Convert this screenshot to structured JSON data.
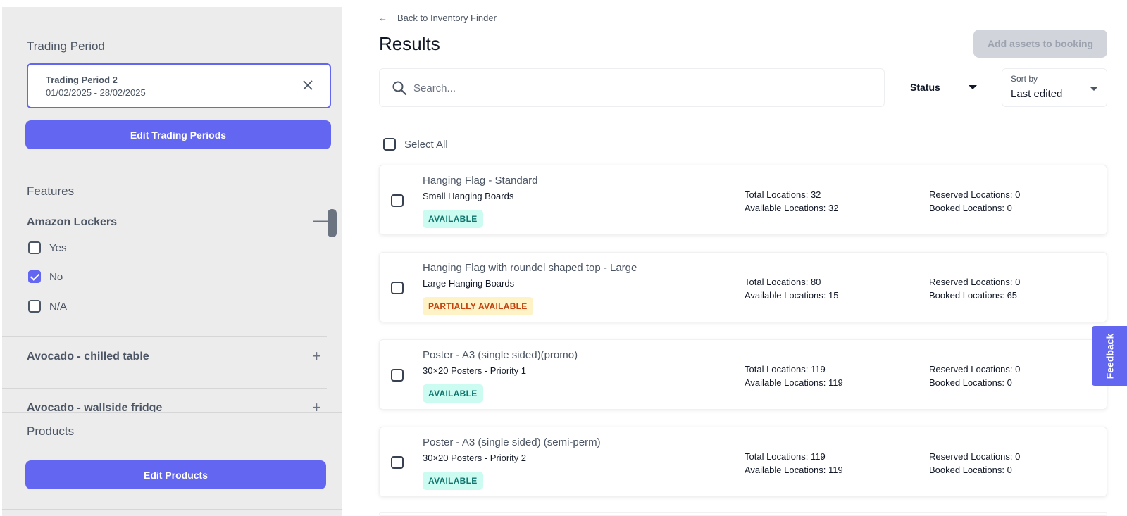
{
  "sidebar": {
    "trading_period": {
      "title": "Trading Period",
      "selected_name": "Trading Period 2",
      "selected_range": "01/02/2025 - 28/02/2025",
      "edit_label": "Edit Trading Periods"
    },
    "features": {
      "title": "Features",
      "groups": [
        {
          "label": "Amazon Lockers",
          "expanded": true,
          "options": [
            {
              "label": "Yes",
              "checked": false
            },
            {
              "label": "No",
              "checked": true
            },
            {
              "label": "N/A",
              "checked": false
            }
          ]
        },
        {
          "label": "Avocado - chilled table",
          "expanded": false
        },
        {
          "label": "Avocado - wallside fridge",
          "expanded": false
        }
      ]
    },
    "products": {
      "title": "Products",
      "edit_label": "Edit Products"
    }
  },
  "main": {
    "back_label": "Back to Inventory Finder",
    "title": "Results",
    "add_button": "Add assets to booking",
    "search_placeholder": "Search...",
    "status_label": "Status",
    "sort": {
      "label": "Sort by",
      "value": "Last edited"
    },
    "select_all": "Select All",
    "results": [
      {
        "title": "Hanging Flag - Standard",
        "subtitle": "Small Hanging Boards",
        "status": "AVAILABLE",
        "total": "Total Locations: 32",
        "available": "Available Locations: 32",
        "reserved": "Reserved Locations: 0",
        "booked": "Booked Locations: 0"
      },
      {
        "title": "Hanging Flag with roundel shaped top - Large",
        "subtitle": "Large Hanging Boards",
        "status": "PARTIALLY AVAILABLE",
        "total": "Total Locations: 80",
        "available": "Available Locations: 15",
        "reserved": "Reserved Locations: 0",
        "booked": "Booked Locations: 65"
      },
      {
        "title": "Poster - A3 (single sided)(promo)",
        "subtitle": "30×20 Posters - Priority 1",
        "status": "AVAILABLE",
        "total": "Total Locations: 119",
        "available": "Available Locations: 119",
        "reserved": "Reserved Locations: 0",
        "booked": "Booked Locations: 0"
      },
      {
        "title": "Poster - A3 (single sided) (semi-perm)",
        "subtitle": "30×20 Posters - Priority 2",
        "status": "AVAILABLE",
        "total": "Total Locations: 119",
        "available": "Available Locations: 119",
        "reserved": "Reserved Locations: 0",
        "booked": "Booked Locations: 0"
      }
    ]
  },
  "feedback_label": "Feedback",
  "colors": {
    "accent": "#6366f1",
    "available_bg": "#ccfbf1",
    "available_fg": "#0f766e",
    "partial_bg": "#fef3c7",
    "partial_fg": "#c2410c"
  }
}
